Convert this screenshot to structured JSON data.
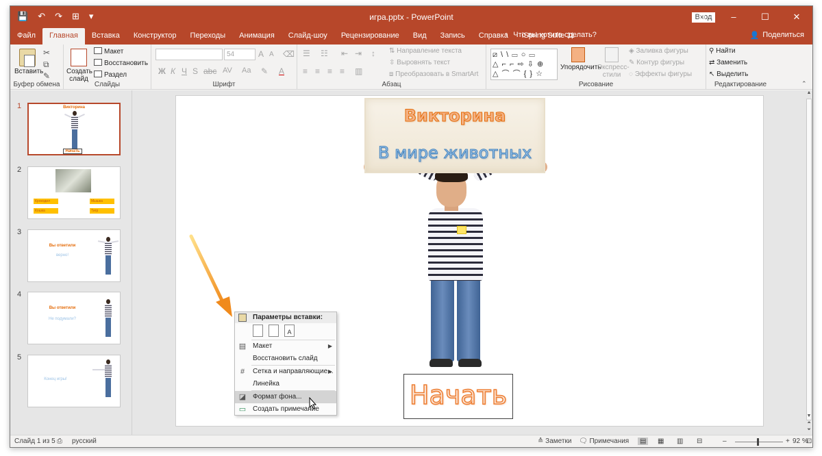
{
  "window": {
    "title": "игра.pptx  -  PowerPoint",
    "signin": "Вход",
    "controls": [
      "⧉",
      "–",
      "☐",
      "✕"
    ]
  },
  "qat": [
    "💾",
    "↶",
    "↷",
    "⊞",
    "▾"
  ],
  "tabs": [
    {
      "label": "Файл"
    },
    {
      "label": "Главная"
    },
    {
      "label": "Вставка"
    },
    {
      "label": "Конструктор"
    },
    {
      "label": "Переходы"
    },
    {
      "label": "Анимация"
    },
    {
      "label": "Слайд-шоу"
    },
    {
      "label": "Рецензирование"
    },
    {
      "label": "Вид"
    },
    {
      "label": "Запись"
    },
    {
      "label": "Справка"
    },
    {
      "label": "iSpring Suite 11"
    }
  ],
  "tell_me": "Что вы хотите сделать?",
  "share": "Поделиться",
  "ribbon": {
    "clipboard": {
      "paste": "Вставить",
      "label": "Буфер обмена"
    },
    "slides": {
      "new_slide_line1": "Создать",
      "new_slide_line2": "слайд",
      "layout": "Макет",
      "reset": "Восстановить",
      "section": "Раздел",
      "label": "Слайды"
    },
    "font": {
      "size": "54",
      "bold": "Ж",
      "italic": "К",
      "underline": "Ч",
      "strike": "S",
      "label": "Шрифт",
      "grow": "A",
      "shrink": "A",
      "spacing": "AV",
      "case": "Aa",
      "clear": "A",
      "color": "A"
    },
    "paragraph": {
      "text_direction": "Направление текста",
      "align_text": "Выровнять текст",
      "smartart": "Преобразовать в SmartArt",
      "label": "Абзац"
    },
    "drawing": {
      "shapes_row1": "⧄ \\ \\ ▭ ○ ▭",
      "shapes_row2": "△ ⌐ ⌐ ⇨ ⇩ ⊕",
      "shapes_row3": "△ ⌒ ⌒ { } ☆",
      "arrange_line1": "Упорядочить",
      "quick_styles_line1": "Экспресс-",
      "quick_styles_line2": "стили",
      "fill": "Заливка фигуры",
      "outline": "Контур фигуры",
      "effects": "Эффекты фигуры",
      "label": "Рисование"
    },
    "editing": {
      "find": "Найти",
      "replace": "Заменить",
      "select": "Выделить",
      "label": "Редактирование"
    }
  },
  "thumbnails": [
    {
      "number": "1",
      "title": "Викторина",
      "tag": "Начать"
    },
    {
      "number": "2",
      "tags": [
        "Крокодил",
        "Мышка",
        "Кошка",
        "Тигр"
      ]
    },
    {
      "number": "3",
      "title": "Вы ответили",
      "sub": "верно!"
    },
    {
      "number": "4",
      "title": "Вы ответили",
      "sub": "Не подумали?"
    },
    {
      "number": "5",
      "sub": "Конец игры!"
    }
  ],
  "slide": {
    "title": "Викторина",
    "subtitle": "В мире животных",
    "start_button": "Начать"
  },
  "context_menu": {
    "header": "Параметры вставки:",
    "paste_options": [
      "📋",
      "📋",
      "A"
    ],
    "items": [
      {
        "label": "Макет",
        "icon": "▤",
        "has_submenu": true
      },
      {
        "label": "Восстановить слайд",
        "icon": "",
        "has_submenu": false
      },
      {
        "label": "Сетка и направляющие...",
        "icon": "#",
        "has_submenu": true
      },
      {
        "label": "Линейка",
        "icon": "",
        "has_submenu": false
      },
      {
        "label": "Формат фона...",
        "icon": "◪",
        "has_submenu": false,
        "highlighted": true
      },
      {
        "label": "Создать примечание",
        "icon": "▭",
        "has_submenu": false
      }
    ]
  },
  "status": {
    "slide_info": "Слайд 1 из 5",
    "language": "русский",
    "notes": "Заметки",
    "comments": "Примечания",
    "zoom": "92 %"
  },
  "colors": {
    "accent": "#b7472a",
    "title_orange": "#e46c0a",
    "subtitle_blue": "#2e75b6"
  }
}
